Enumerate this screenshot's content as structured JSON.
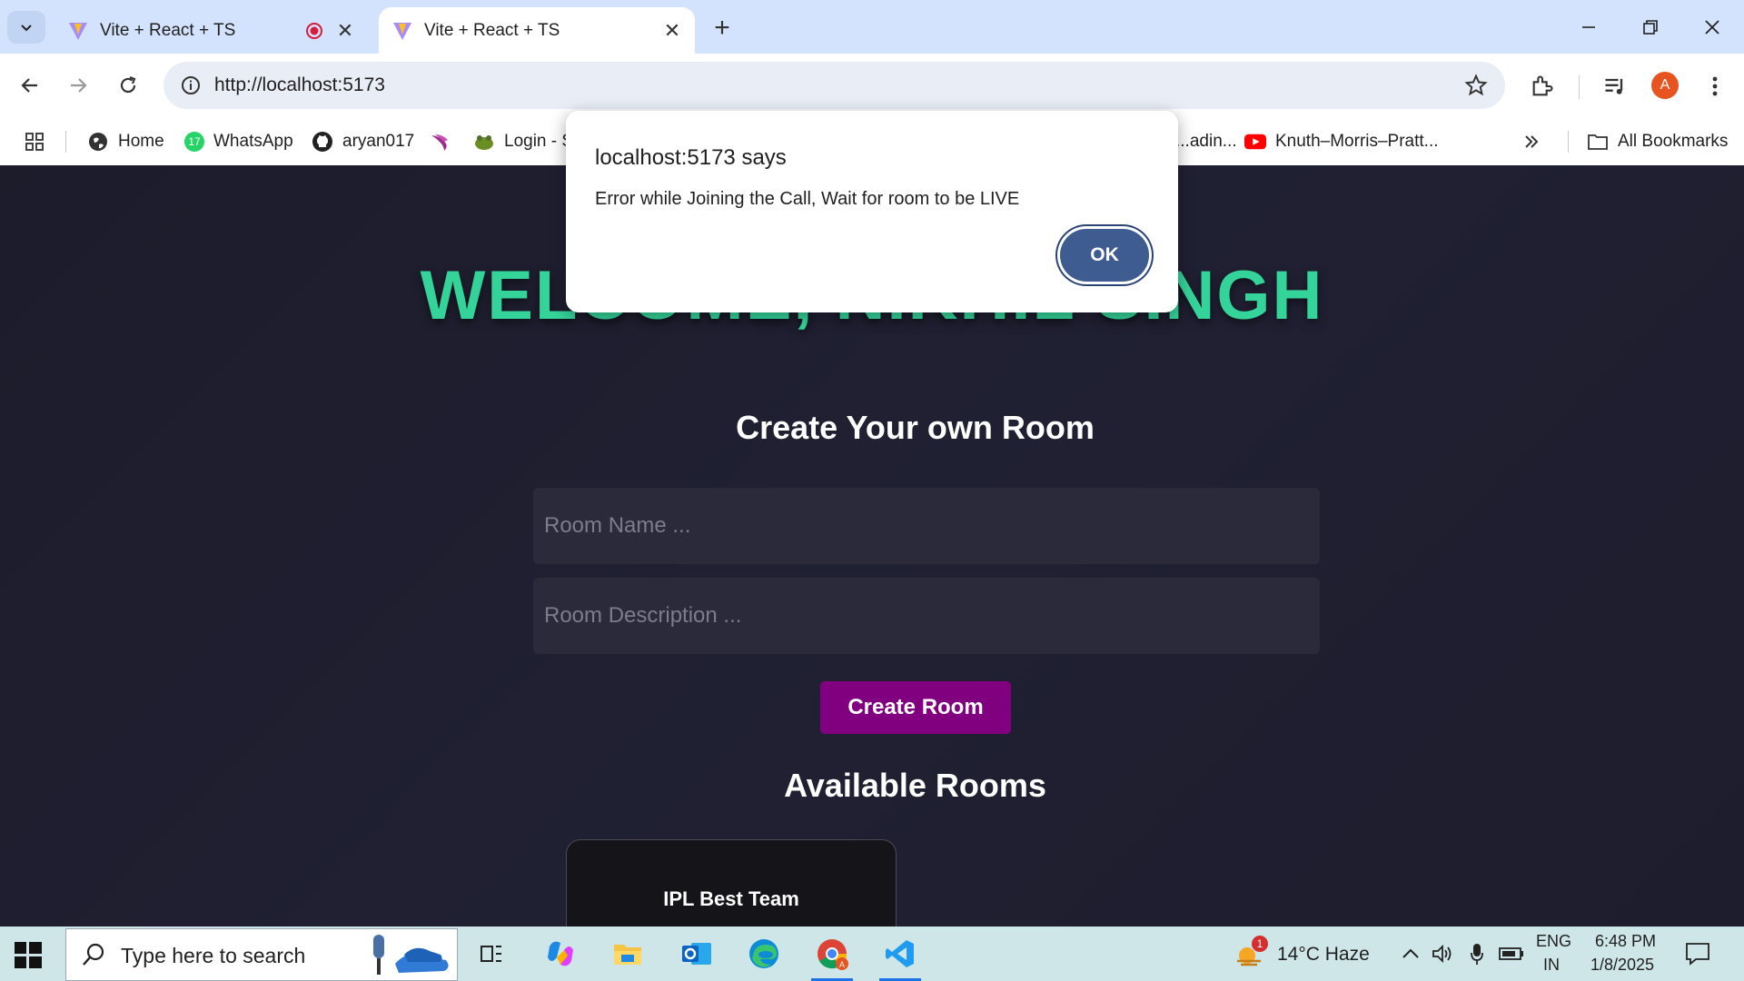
{
  "browser": {
    "tabs": [
      {
        "title": "Vite + React + TS",
        "active": false,
        "recording": true
      },
      {
        "title": "Vite + React + TS",
        "active": true,
        "recording": false
      }
    ],
    "url": "http://localhost:5173",
    "bookmarks": [
      "Home",
      "WhatsApp",
      "aryan017",
      "Login - S",
      "...adin...",
      "Knuth–Morris–Pratt...",
      "All Bookmarks"
    ],
    "whatsapp_badge": "17",
    "profile_initial": "A"
  },
  "page": {
    "welcome_text": "WELCOME, NIKHIL SINGH",
    "create_heading": "Create Your own Room",
    "room_name_placeholder": "Room Name ...",
    "room_desc_placeholder": "Room Description ...",
    "create_button": "Create Room",
    "available_heading": "Available Rooms",
    "rooms": [
      {
        "name": "IPL Best Team"
      }
    ]
  },
  "dialog": {
    "title": "localhost:5173 says",
    "message": "Error while Joining the Call, Wait for room to be LIVE",
    "ok_label": "OK"
  },
  "taskbar": {
    "search_placeholder": "Type here to search",
    "weather": "14°C  Haze",
    "weather_badge": "1",
    "lang_top": "ENG",
    "lang_bottom": "IN",
    "time": "6:48 PM",
    "date": "1/8/2025"
  },
  "colors": {
    "accent_green": "#34d399",
    "button_purple": "#800080",
    "ok_blue": "#3e5c8f"
  }
}
